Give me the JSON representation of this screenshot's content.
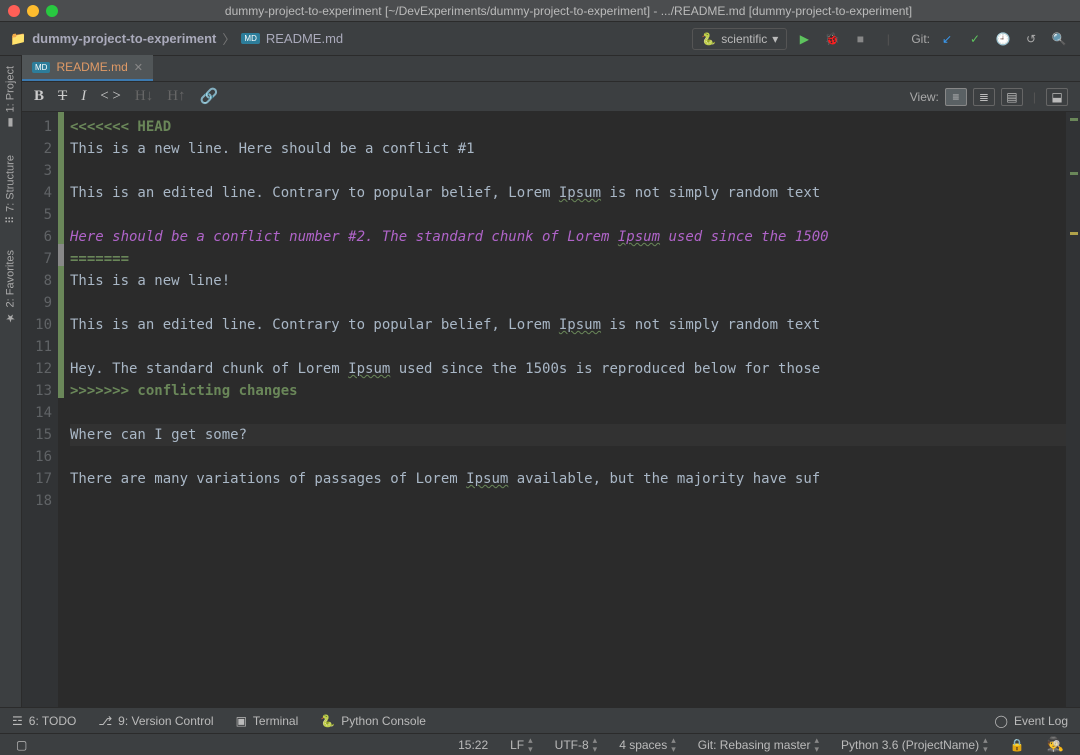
{
  "window": {
    "title": "dummy-project-to-experiment [~/DevExperiments/dummy-project-to-experiment] - .../README.md [dummy-project-to-experiment]"
  },
  "breadcrumb": {
    "project": "dummy-project-to-experiment",
    "file": "README.md"
  },
  "run_config": {
    "label": "scientific"
  },
  "git_label": "Git:",
  "tabs": [
    {
      "label": "README.md"
    }
  ],
  "md_toolbar": {
    "bold": "B",
    "strike": "T",
    "italic": "I",
    "code": "< >",
    "hdown": "H↓",
    "hup": "H↑",
    "link": "🔗",
    "view_label": "View:"
  },
  "left_tabs": {
    "project": "1: Project",
    "structure": "7: Structure",
    "favorites": "2: Favorites"
  },
  "editor": {
    "lines": [
      {
        "n": 1,
        "cls": "cl-marker",
        "text": "<<<<<<< HEAD",
        "mk": "head"
      },
      {
        "n": 2,
        "cls": "",
        "text": "This is a new line. Here should be a conflict #1",
        "mk": "head"
      },
      {
        "n": 3,
        "cls": "",
        "text": "",
        "mk": "head"
      },
      {
        "n": 4,
        "cls": "",
        "text": "This is an edited line. Contrary to popular belief, Lorem Ipsum is not simply random text",
        "mk": "head",
        "wave": "Ipsum"
      },
      {
        "n": 5,
        "cls": "",
        "text": "",
        "mk": "head"
      },
      {
        "n": 6,
        "cls": "cl-italic",
        "text": "Here should be a conflict number #2. The standard chunk of Lorem Ipsum used since the 1500",
        "mk": "head",
        "wave": "Ipsum"
      },
      {
        "n": 7,
        "cls": "cl-sep",
        "text": "=======",
        "mk": "sep"
      },
      {
        "n": 8,
        "cls": "",
        "text": "This is a new line!",
        "mk": "inc"
      },
      {
        "n": 9,
        "cls": "",
        "text": "",
        "mk": "inc"
      },
      {
        "n": 10,
        "cls": "",
        "text": "This is an edited line. Contrary to popular belief, Lorem Ipsum is not simply random text",
        "mk": "inc",
        "wave": "Ipsum"
      },
      {
        "n": 11,
        "cls": "",
        "text": "",
        "mk": "inc"
      },
      {
        "n": 12,
        "cls": "",
        "text": "Hey. The standard chunk of Lorem Ipsum used since the 1500s is reproduced below for those",
        "mk": "inc",
        "wave": "Ipsum"
      },
      {
        "n": 13,
        "cls": "cl-inc",
        "text": ">>>>>>> conflicting changes",
        "mk": "inc"
      },
      {
        "n": 14,
        "cls": "",
        "text": ""
      },
      {
        "n": 15,
        "cls": "cl-current",
        "text": "Where can I get some?"
      },
      {
        "n": 16,
        "cls": "",
        "text": ""
      },
      {
        "n": 17,
        "cls": "",
        "text": "There are many variations of passages of Lorem Ipsum available, but the majority have suf",
        "wave": "Ipsum"
      },
      {
        "n": 18,
        "cls": "",
        "text": ""
      }
    ]
  },
  "bottom_windows": {
    "todo": "6: TODO",
    "vcs": "9: Version Control",
    "terminal": "Terminal",
    "pyconsole": "Python Console",
    "eventlog": "Event Log"
  },
  "status": {
    "pos": "15:22",
    "eol": "LF",
    "enc": "UTF-8",
    "indent": "4 spaces",
    "git": "Git: Rebasing master",
    "interp": "Python 3.6 (ProjectName)"
  }
}
